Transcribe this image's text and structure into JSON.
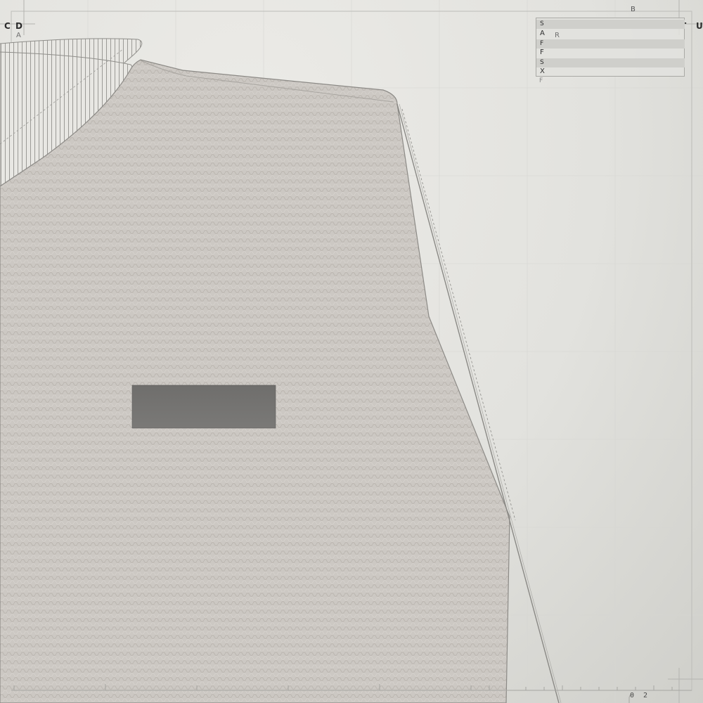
{
  "labels": {
    "top_left_c": "C",
    "top_left_d": "D",
    "top_left_a": "A",
    "top_center_b": "B",
    "top_right_t": "T",
    "top_right_u": "U",
    "panel_note_r": "R",
    "bottom_right_0": "0",
    "bottom_right_2": "2"
  },
  "legend": {
    "items": [
      "S",
      "A",
      "F",
      "F",
      "S",
      "X"
    ],
    "trailing": "F"
  },
  "colors": {
    "background": "#e4e4e0",
    "main_shape": "#ccc8c3",
    "main_shape_outline": "#8c8a86",
    "dark_rectangle": "#727170",
    "hatch_lines": "#9b9a96",
    "guide_lines": "#c9c9c5",
    "legend_shade": "#cfcfcb"
  }
}
